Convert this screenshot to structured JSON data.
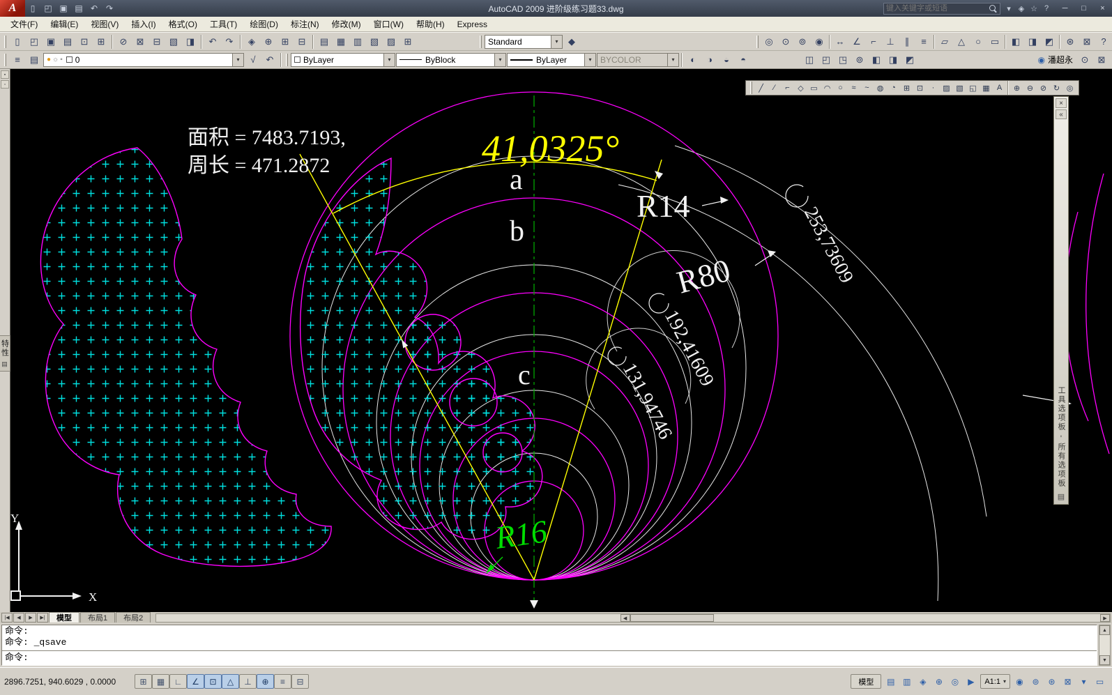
{
  "ui": {
    "dropdown_arrow": "▾",
    "scroll_up": "▲",
    "scroll_down": "▼",
    "left_arrow": "◀",
    "right_arrow": "▶"
  },
  "colors": {
    "canvas_bg": "#000000",
    "geometry_magenta": "#ff00ff",
    "hatch_cyan": "#00e0e0",
    "dimension_yellow": "#ffff00",
    "radius_green": "#00dd00",
    "centerline_green": "#00b300",
    "annotation_white": "#f2f2f2"
  },
  "titlebar": {
    "logo": "A",
    "title": "AutoCAD 2009 进阶级练习题33.dwg",
    "search_placeholder": "键入关键字或短语",
    "quick_access": [
      {
        "n": "new-file-icon",
        "g": "▯"
      },
      {
        "n": "open-file-icon",
        "g": "◰"
      },
      {
        "n": "save-icon",
        "g": "▣"
      },
      {
        "n": "plot-icon",
        "g": "▤"
      },
      {
        "n": "undo-icon",
        "g": "↶"
      },
      {
        "n": "redo-icon",
        "g": "↷"
      }
    ],
    "info_icons": [
      {
        "n": "search-options-icon",
        "g": "▾"
      },
      {
        "n": "communication-center-icon",
        "g": "◈"
      },
      {
        "n": "favorites-icon",
        "g": "☆"
      },
      {
        "n": "help-icon",
        "g": "?"
      }
    ],
    "window_buttons": [
      {
        "n": "minimize-button",
        "g": "─"
      },
      {
        "n": "restore-button",
        "g": "□"
      },
      {
        "n": "close-button",
        "g": "×"
      }
    ]
  },
  "menu": {
    "items": [
      "文件(F)",
      "编辑(E)",
      "视图(V)",
      "插入(I)",
      "格式(O)",
      "工具(T)",
      "绘图(D)",
      "标注(N)",
      "修改(M)",
      "窗口(W)",
      "帮助(H)",
      "Express"
    ]
  },
  "toolbar1": {
    "file_icons": [
      {
        "n": "new-file-icon",
        "g": "▯"
      },
      {
        "n": "open-file-icon",
        "g": "◰"
      },
      {
        "n": "save-icon",
        "g": "▣"
      },
      {
        "n": "plot-icon",
        "g": "▤"
      },
      {
        "n": "plot-preview-icon",
        "g": "⊡"
      },
      {
        "n": "publish-icon",
        "g": "⊞"
      }
    ],
    "edit_icons": [
      {
        "n": "cut-icon",
        "g": "⊘"
      },
      {
        "n": "copy-icon",
        "g": "⊠"
      },
      {
        "n": "paste-icon",
        "g": "⊟"
      },
      {
        "n": "match-properties-icon",
        "g": "▧"
      },
      {
        "n": "block-editor-icon",
        "g": "◨"
      }
    ],
    "undo_icons": [
      {
        "n": "undo-icon",
        "g": "↶"
      },
      {
        "n": "redo-icon",
        "g": "↷"
      }
    ],
    "zoom_icons": [
      {
        "n": "pan-icon",
        "g": "◈"
      },
      {
        "n": "zoom-realtime-icon",
        "g": "⊕"
      },
      {
        "n": "zoom-window-icon",
        "g": "⊞"
      },
      {
        "n": "zoom-previous-icon",
        "g": "⊟"
      }
    ],
    "palette_icons": [
      {
        "n": "properties-palette-icon",
        "g": "▤"
      },
      {
        "n": "designcenter-icon",
        "g": "▦"
      },
      {
        "n": "tool-palettes-icon",
        "g": "▥"
      },
      {
        "n": "sheet-set-manager-icon",
        "g": "▧"
      },
      {
        "n": "markup-set-manager-icon",
        "g": "▨"
      },
      {
        "n": "quickcalc-icon",
        "g": "⊞"
      }
    ],
    "style_label": "Standard",
    "style_extra": [
      {
        "n": "text-style-manager-icon",
        "g": "◆"
      }
    ],
    "right_a": [
      {
        "n": "ucs-icon",
        "g": "◎"
      },
      {
        "n": "ucs-world-icon",
        "g": "⊙"
      },
      {
        "n": "named-views-icon",
        "g": "⊚"
      },
      {
        "n": "orbit-icon",
        "g": "◉"
      }
    ],
    "right_b": [
      {
        "n": "dim-linear-icon",
        "g": "↔"
      },
      {
        "n": "dim-aligned-icon",
        "g": "∠"
      },
      {
        "n": "dim-radius-icon",
        "g": "⌐"
      },
      {
        "n": "dim-angular-icon",
        "g": "⊥"
      },
      {
        "n": "dim-baseline-icon",
        "g": "∥"
      },
      {
        "n": "dim-style-icon",
        "g": "≡"
      }
    ],
    "right_c": [
      {
        "n": "region-icon",
        "g": "▱"
      },
      {
        "n": "polygon-icon",
        "g": "△"
      },
      {
        "n": "circle-tool-icon",
        "g": "○"
      },
      {
        "n": "rectangle-tool-icon",
        "g": "▭"
      }
    ],
    "right_d": [
      {
        "n": "visual-style-icon",
        "g": "◧"
      },
      {
        "n": "shade-icon",
        "g": "◨"
      },
      {
        "n": "wireframe-icon",
        "g": "◩"
      }
    ],
    "right_e": [
      {
        "n": "workspace-icon",
        "g": "⊛"
      },
      {
        "n": "options-icon",
        "g": "⊠"
      },
      {
        "n": "help-tool-icon",
        "g": "?"
      }
    ]
  },
  "toolbar2": {
    "layer_tool_icons": [
      {
        "n": "layer-properties-manager-icon",
        "g": "≡"
      },
      {
        "n": "layer-states-manager-icon",
        "g": "▤"
      }
    ],
    "layer_status_icons": [
      "●",
      "☼",
      "◦"
    ],
    "layer_value": "0",
    "layer_extra_icons": [
      {
        "n": "make-object-layer-current-icon",
        "g": "√"
      },
      {
        "n": "layer-previous-icon",
        "g": "↶"
      }
    ],
    "color_value": "ByLayer",
    "linetype_value": "ByBlock",
    "lineweight_value": "ByLayer",
    "plot_style_value": "BYCOLOR",
    "right_a": [
      {
        "n": "draw-order-front-icon",
        "g": "◐"
      },
      {
        "n": "draw-order-back-icon",
        "g": "◑"
      },
      {
        "n": "draw-order-above-icon",
        "g": "◒"
      },
      {
        "n": "draw-order-under-icon",
        "g": "◓"
      }
    ],
    "right_b": [
      {
        "n": "named-views-icon",
        "g": "◫"
      },
      {
        "n": "3d-views-icon",
        "g": "◰"
      },
      {
        "n": "camera-icon",
        "g": "◳"
      },
      {
        "n": "orbit-icon",
        "g": "⊚"
      },
      {
        "n": "visual-styles-icon",
        "g": "◧"
      },
      {
        "n": "render-icon",
        "g": "◨"
      },
      {
        "n": "materials-icon",
        "g": "◩"
      }
    ],
    "user_icon": {
      "n": "user-icon",
      "g": "◉"
    },
    "user_name": "潘超永",
    "right_c": [
      {
        "n": "communication-icon",
        "g": "⊙"
      },
      {
        "n": "lock-icon",
        "g": "⊠"
      }
    ]
  },
  "left_strip": {
    "top_icons": [
      {
        "n": "dock-close-icon",
        "g": "▪"
      },
      {
        "n": "dock-grid-icon",
        "g": "▫"
      }
    ],
    "tab_label": "特性",
    "tab_icon": "▤"
  },
  "draw_toolbar": {
    "icons": [
      {
        "n": "line-icon",
        "g": "╱"
      },
      {
        "n": "construction-line-icon",
        "g": "∕"
      },
      {
        "n": "polyline-icon",
        "g": "⌐"
      },
      {
        "n": "polygon-icon",
        "g": "◇"
      },
      {
        "n": "rectangle-icon",
        "g": "▭"
      },
      {
        "n": "arc-icon",
        "g": "◠"
      },
      {
        "n": "circle-icon",
        "g": "○"
      },
      {
        "n": "revision-cloud-icon",
        "g": "≈"
      },
      {
        "n": "spline-icon",
        "g": "~"
      },
      {
        "n": "ellipse-icon",
        "g": "◍"
      },
      {
        "n": "ellipse-arc-icon",
        "g": "◔"
      },
      {
        "n": "insert-block-icon",
        "g": "⊞"
      },
      {
        "n": "make-block-icon",
        "g": "⊡"
      },
      {
        "n": "point-icon",
        "g": "·"
      },
      {
        "n": "hatch-icon",
        "g": "▨"
      },
      {
        "n": "gradient-icon",
        "g": "▧"
      },
      {
        "n": "region-icon",
        "g": "◱"
      },
      {
        "n": "table-icon",
        "g": "▦"
      },
      {
        "n": "multiline-text-icon",
        "g": "A"
      }
    ],
    "extra_icons": [
      {
        "n": "move-icon",
        "g": "⊕"
      },
      {
        "n": "erase-icon",
        "g": "⊖"
      },
      {
        "n": "trim-icon",
        "g": "⊘"
      },
      {
        "n": "rotate-icon",
        "g": "↻"
      },
      {
        "n": "mirror-icon",
        "g": "◎"
      }
    ]
  },
  "palette": {
    "title": "工具选项板 - 所有选项板",
    "close_glyph": "×",
    "pin_glyph": "«",
    "foot_glyph": "▤"
  },
  "drawing": {
    "area_text": "面积 = 7483.7193,",
    "perimeter_text": "周长 = 471.2872",
    "angle_text": "41,0325°",
    "label_a": "a",
    "label_b": "b",
    "label_c": "c",
    "r14_text": "R14",
    "r80_text": "R80",
    "r16_text": "R16",
    "dim_labels": [
      "253,73609",
      "192,41609",
      "131,94746"
    ],
    "axis_x": "X",
    "axis_y": "Y"
  },
  "tabs": {
    "nav": [
      "|◀",
      "◀",
      "▶",
      "▶|"
    ],
    "items": [
      {
        "label": "模型",
        "active": true
      },
      {
        "label": "布局1",
        "active": false
      },
      {
        "label": "布局2",
        "active": false
      }
    ]
  },
  "command": {
    "history": [
      "命令:",
      "命令: _qsave"
    ],
    "prompt": "命令:"
  },
  "statusbar": {
    "coords": "2896.7251, 940.6029 ,  0.0000",
    "toggles": [
      {
        "n": "snap-toggle",
        "g": "⊞",
        "on": false
      },
      {
        "n": "grid-toggle",
        "g": "▦",
        "on": false
      },
      {
        "n": "ortho-toggle",
        "g": "∟",
        "on": false
      },
      {
        "n": "polar-toggle",
        "g": "∠",
        "on": true
      },
      {
        "n": "osnap-toggle",
        "g": "⊡",
        "on": true
      },
      {
        "n": "otrack-toggle",
        "g": "△",
        "on": true
      },
      {
        "n": "ducs-toggle",
        "g": "⊥",
        "on": false
      },
      {
        "n": "dyn-toggle",
        "g": "⊕",
        "on": true
      },
      {
        "n": "lwt-toggle",
        "g": "≡",
        "on": false
      },
      {
        "n": "qp-toggle",
        "g": "⊟",
        "on": false
      }
    ],
    "model_label": "模型",
    "nav_icons": [
      {
        "n": "quick-view-layouts-icon",
        "g": "▤"
      },
      {
        "n": "quick-view-drawings-icon",
        "g": "▥"
      },
      {
        "n": "pan-status-icon",
        "g": "◈"
      },
      {
        "n": "zoom-status-icon",
        "g": "⊕"
      },
      {
        "n": "steeringwheel-icon",
        "g": "◎"
      },
      {
        "n": "showmotion-icon",
        "g": "▶"
      }
    ],
    "annotation_scale": "A1:1",
    "right_icons": [
      {
        "n": "annotation-visibility-icon",
        "g": "◉"
      },
      {
        "n": "annotation-autoscale-icon",
        "g": "⊚"
      },
      {
        "n": "workspace-switch-icon",
        "g": "⊛"
      },
      {
        "n": "toolbar-lock-icon",
        "g": "⊠"
      },
      {
        "n": "tray-arrow-icon",
        "g": "▾"
      },
      {
        "n": "clean-screen-icon",
        "g": "▭"
      }
    ]
  }
}
